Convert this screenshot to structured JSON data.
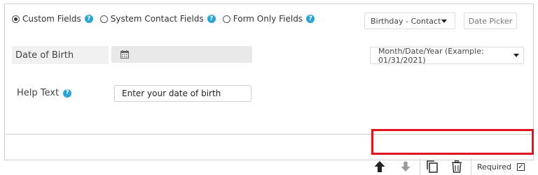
{
  "field_source": {
    "options": [
      {
        "label": "Custom Fields",
        "checked": true
      },
      {
        "label": "System Contact Fields",
        "checked": false
      },
      {
        "label": "Form Only Fields",
        "checked": false
      }
    ]
  },
  "field_select": {
    "value": "Birthday - Contact"
  },
  "date_picker_button": {
    "label": "Date Picker"
  },
  "field": {
    "label": "Date of Birth",
    "format_select": "Month/Date/Year (Example: 01/31/2021)"
  },
  "help_text": {
    "label": "Help Text",
    "value": "Enter your date of birth"
  },
  "toolbar": {
    "required_label": "Required",
    "required_checked": true
  },
  "colors": {
    "help_icon": "#2aa3d6",
    "highlight_border": "#e0141e"
  },
  "icons": {
    "help": "question-circle-icon",
    "calendar": "calendar-icon",
    "up": "arrow-up-icon",
    "down": "arrow-down-icon",
    "copy": "copy-icon",
    "delete": "trash-icon"
  }
}
